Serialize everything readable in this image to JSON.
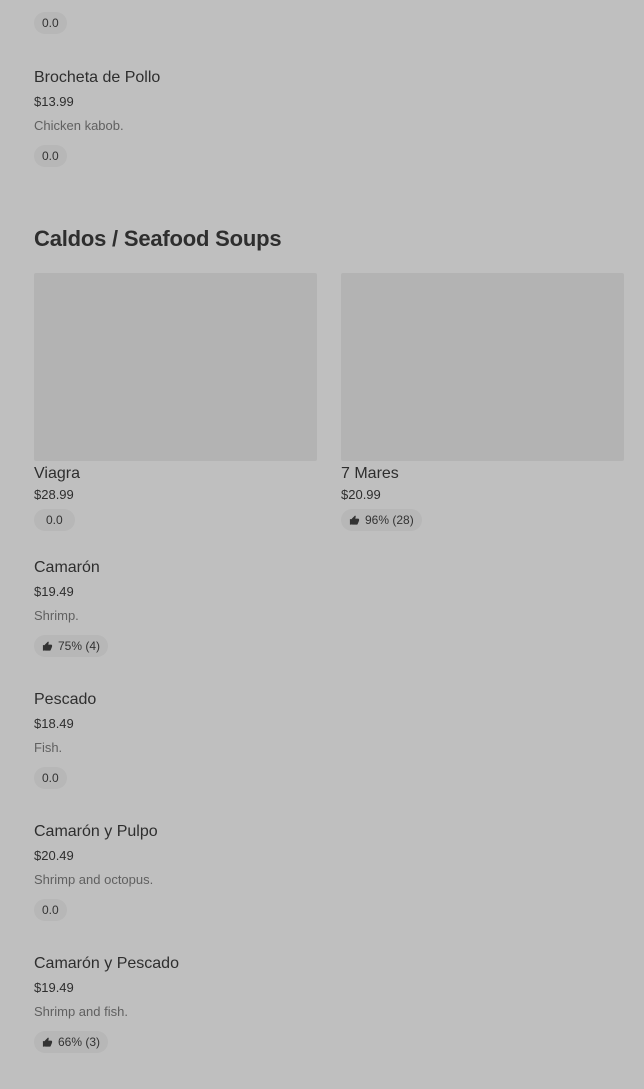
{
  "prev_item": {
    "rating": "0.0"
  },
  "items_top": [
    {
      "name": "Brocheta de Pollo",
      "price": "$13.99",
      "description": "Chicken kabob.",
      "rating": "0.0"
    }
  ],
  "section": {
    "title": "Caldos / Seafood Soups"
  },
  "featured_cards": [
    {
      "name": "Viagra",
      "price": "$28.99",
      "rating": "0.0",
      "has_thumb": false
    },
    {
      "name": "7 Mares",
      "price": "$20.99",
      "rating": "96% (28)",
      "has_thumb": true
    }
  ],
  "items": [
    {
      "name": "Camarón",
      "price": "$19.49",
      "description": "Shrimp.",
      "rating": "75% (4)",
      "has_thumb": true
    },
    {
      "name": "Pescado",
      "price": "$18.49",
      "description": "Fish.",
      "rating": "0.0",
      "has_thumb": false
    },
    {
      "name": "Camarón y Pulpo",
      "price": "$20.49",
      "description": "Shrimp and octopus.",
      "rating": "0.0",
      "has_thumb": false
    },
    {
      "name": "Camarón y Pescado",
      "price": "$19.49",
      "description": "Shrimp and fish.",
      "rating": "66% (3)",
      "has_thumb": true
    }
  ],
  "colors": {
    "background": "#bfbfbf",
    "pill": "#b7b7b7",
    "image_placeholder": "#b3b3b3"
  }
}
